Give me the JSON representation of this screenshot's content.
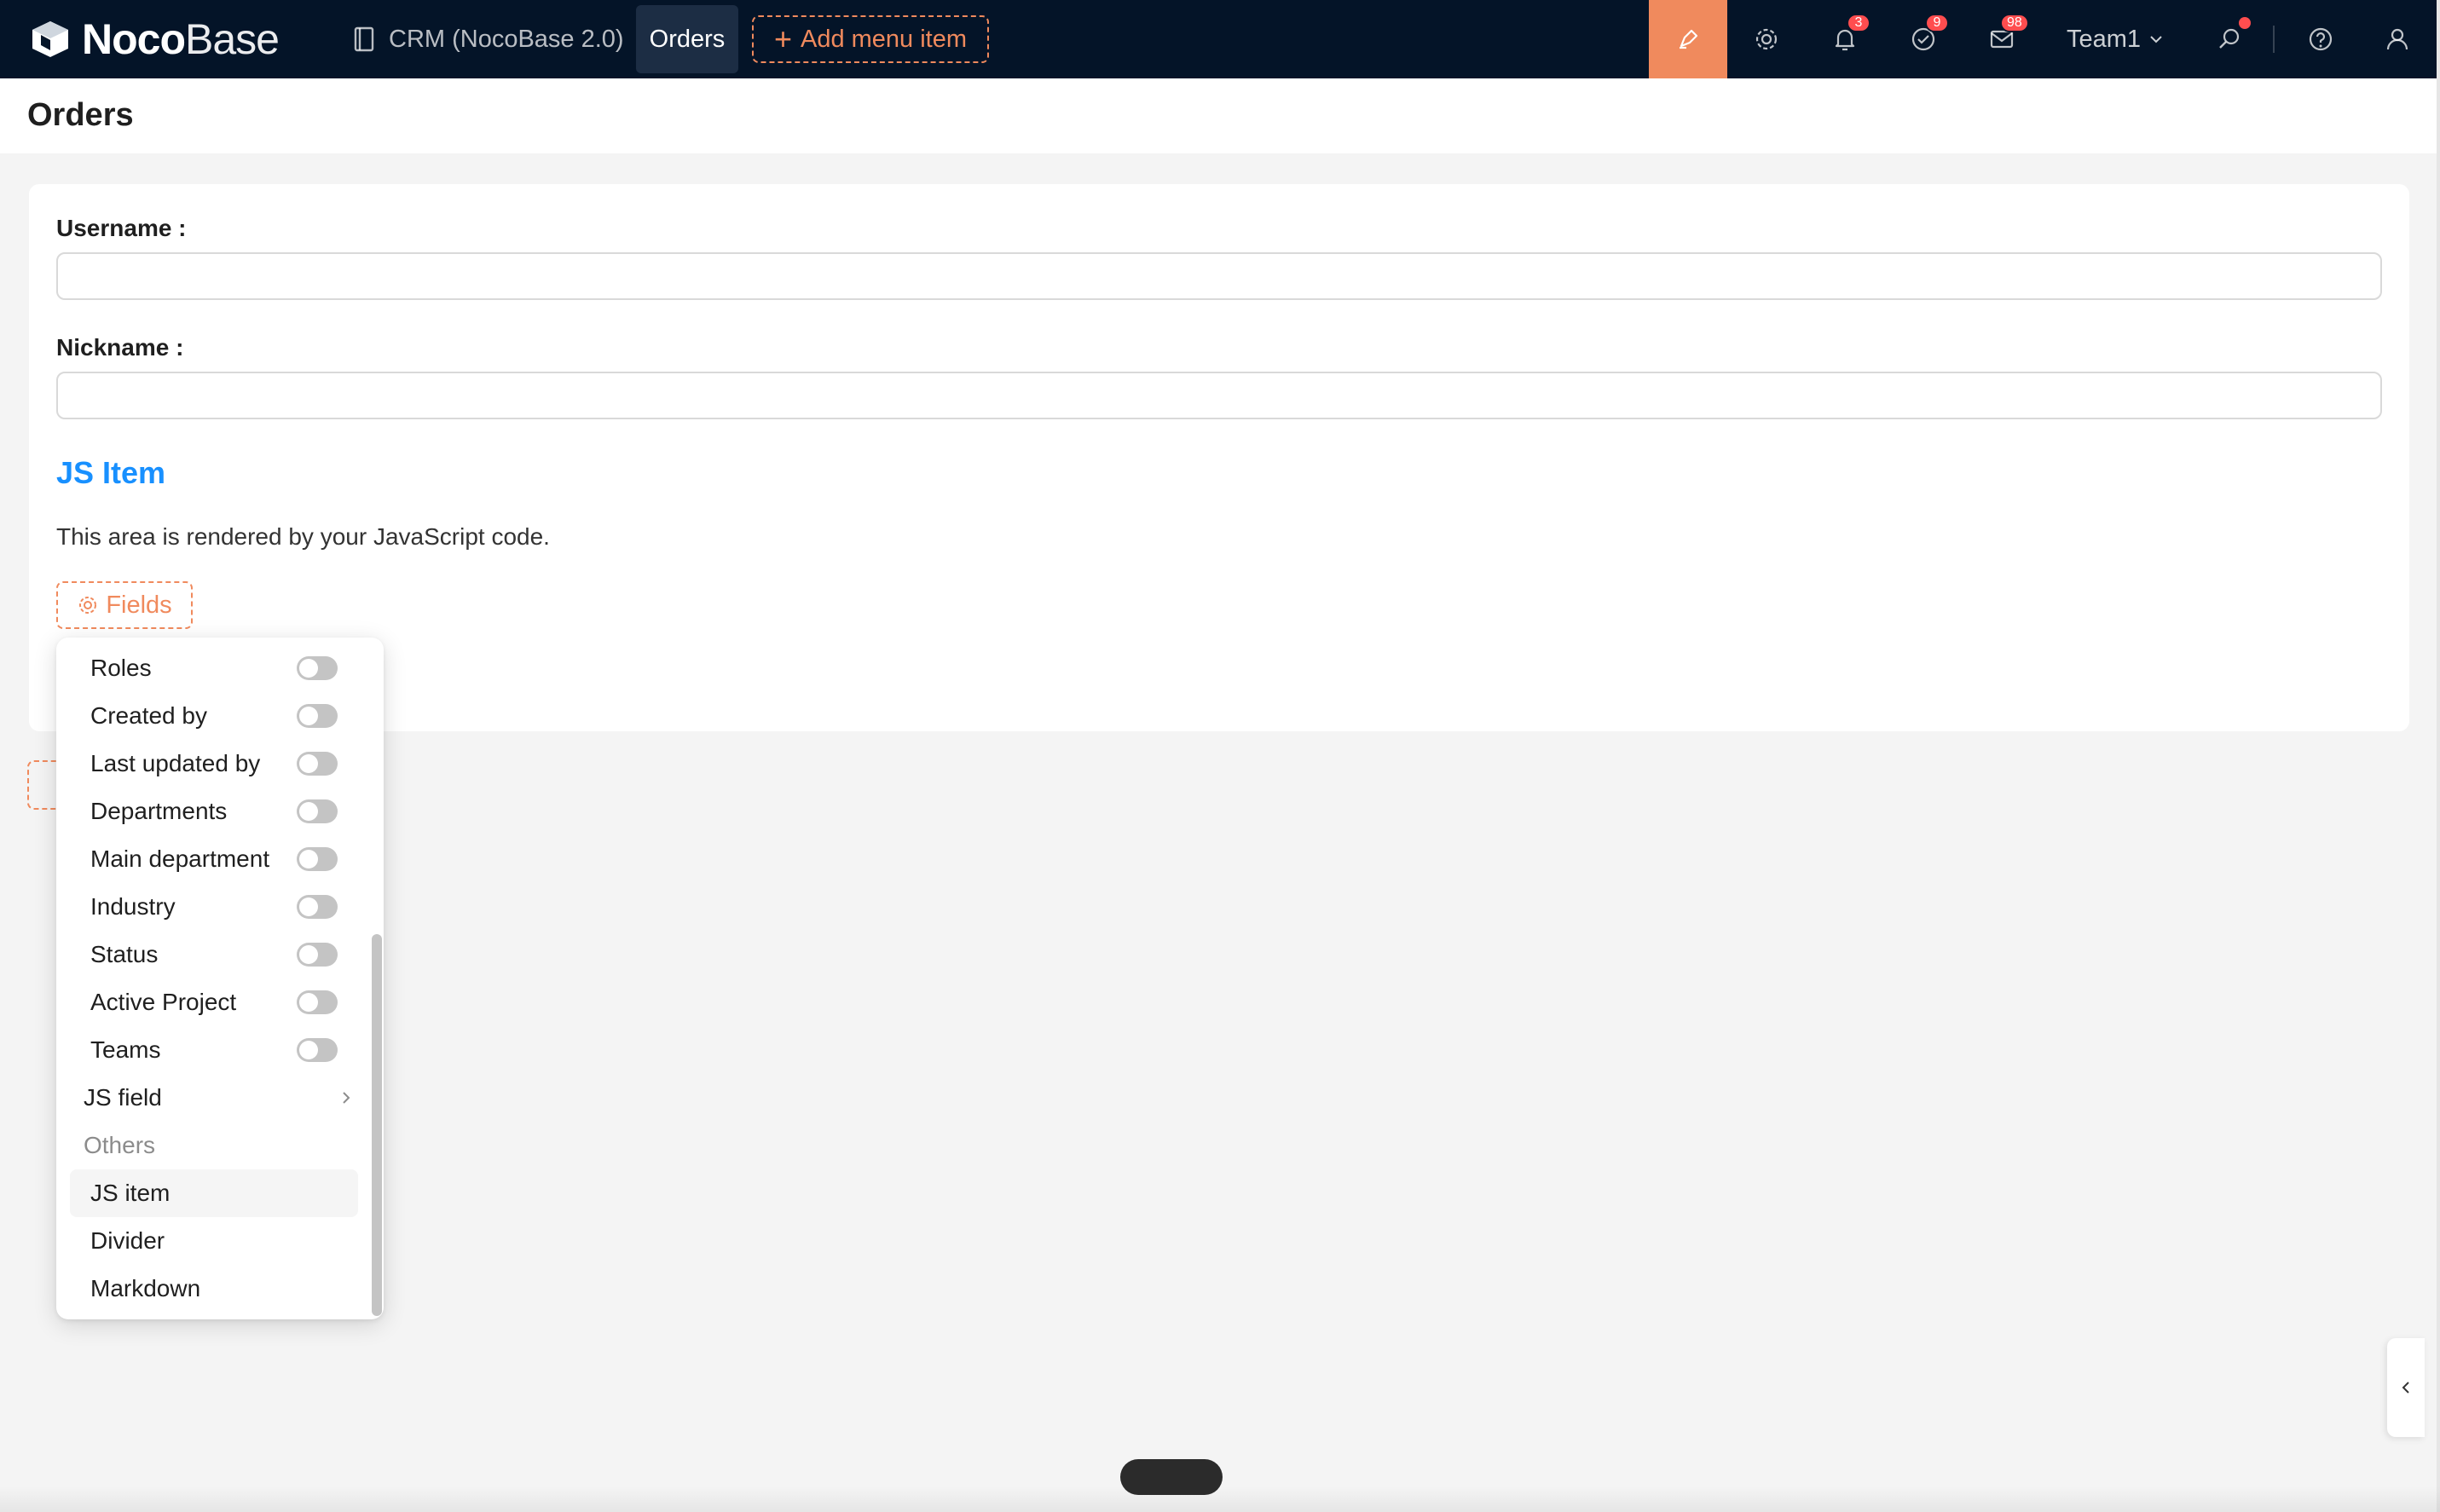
{
  "topbar": {
    "logo_bold": "Noco",
    "logo_light": "Base",
    "app_name": "CRM (NocoBase 2.0)",
    "active_menu": "Orders",
    "add_menu_label": "Add menu item",
    "notifications_count": "3",
    "tasks_count": "9",
    "messages_count": "98",
    "team": "Team1",
    "icons": [
      "ui-editor-icon",
      "settings-icon",
      "bell-icon",
      "check-circle-icon",
      "mail-icon",
      "search-icon",
      "help-icon",
      "user-icon"
    ]
  },
  "page": {
    "title": "Orders"
  },
  "form": {
    "username_label": "Username :",
    "username_value": "",
    "nickname_label": "Nickname :",
    "nickname_value": "",
    "js_item_title": "JS Item",
    "js_item_desc": "This area is rendered by your JavaScript code.",
    "fields_button": "Fields"
  },
  "dropdown": {
    "toggle_items": [
      {
        "label": "Roles",
        "enabled": false
      },
      {
        "label": "Created by",
        "enabled": false
      },
      {
        "label": "Last updated by",
        "enabled": false
      },
      {
        "label": "Departments",
        "enabled": false
      },
      {
        "label": "Main department",
        "enabled": false
      },
      {
        "label": "Industry",
        "enabled": false
      },
      {
        "label": "Status",
        "enabled": false
      },
      {
        "label": "Active Project",
        "enabled": false
      },
      {
        "label": "Teams",
        "enabled": false
      }
    ],
    "submenu_label": "JS field",
    "group_label": "Others",
    "other_items": [
      "JS item",
      "Divider",
      "Markdown"
    ]
  },
  "colors": {
    "topbar_bg": "#041428",
    "accent": "#f08a5d",
    "link": "#1890ff",
    "badge": "#ff4d4f"
  }
}
